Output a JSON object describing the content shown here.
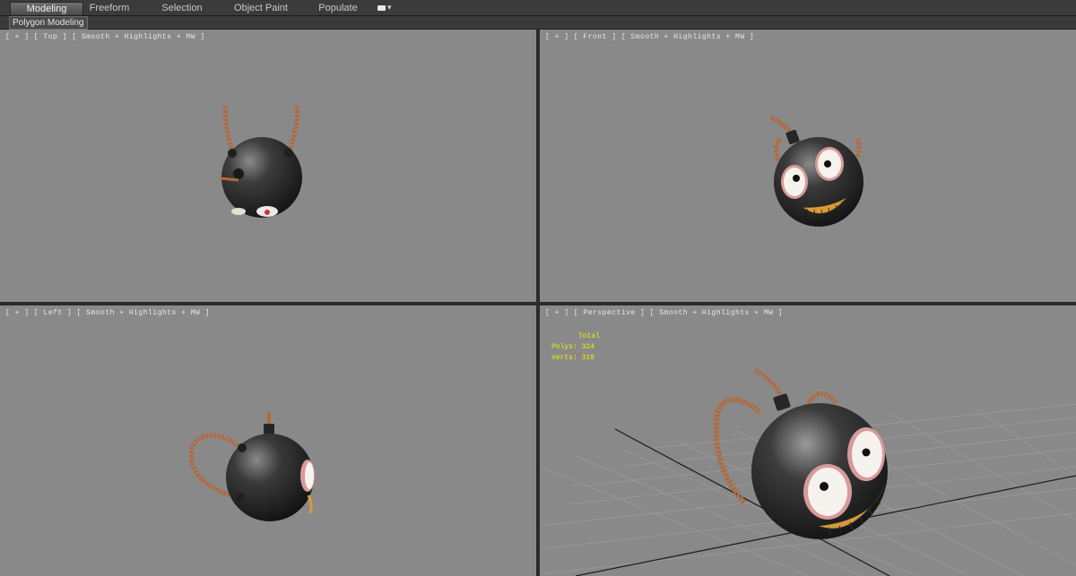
{
  "ribbon": {
    "tabs": [
      {
        "label": "Modeling",
        "active": true
      },
      {
        "label": "Freeform",
        "active": false
      },
      {
        "label": "Selection",
        "active": false
      },
      {
        "label": "Object Paint",
        "active": false
      },
      {
        "label": "Populate",
        "active": false
      }
    ],
    "extra_dropdown_icon": "camera-icon",
    "panel_label": "Polygon Modeling"
  },
  "viewports": {
    "top": {
      "label": "[ + ] [ Top ] [ Smooth + Highlights + MW ]"
    },
    "front": {
      "label": "[ + ] [ Front ] [ Smooth + Highlights + MW ]"
    },
    "left": {
      "label": "[ + ] [ Left ] [ Smooth + Highlights + MW ]"
    },
    "perspective": {
      "label": "[ + ] [ Perspective ] [ Smooth + Highlights + MW ]"
    }
  },
  "stats": {
    "total_label": "Total",
    "polys": "Polys: 324",
    "verts": "Verts: 319"
  },
  "colors": {
    "viewport_bg": "#898989",
    "bomb_body": "#2e2e2e",
    "rope": "#b4693a",
    "stats_text": "#f0f000"
  }
}
